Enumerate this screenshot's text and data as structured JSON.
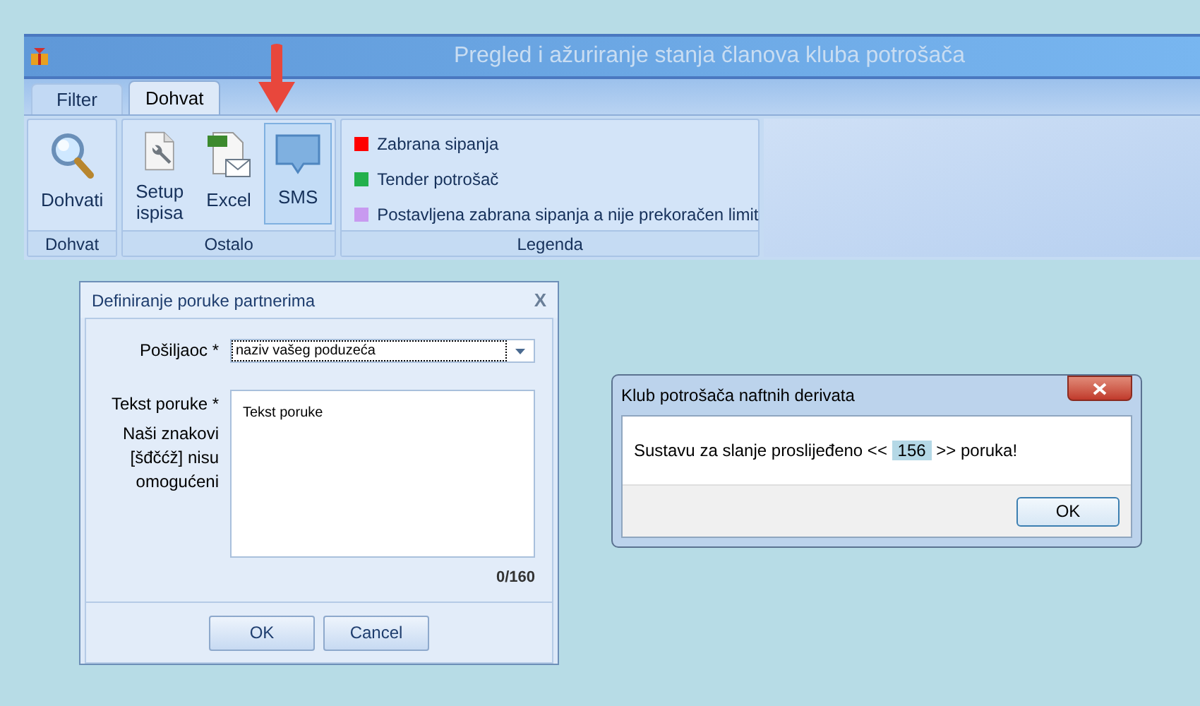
{
  "window": {
    "title": "Pregled i ažuriranje stanja članova kluba potrošača"
  },
  "tabs": [
    {
      "label": "Filter",
      "selected": false
    },
    {
      "label": "Dohvat",
      "selected": true
    }
  ],
  "ribbon": {
    "groups": [
      {
        "label": "Dohvat",
        "kind": "buttons",
        "buttons": [
          {
            "label": "Dohvati",
            "kind": "search",
            "selected": false
          }
        ]
      },
      {
        "label": "Ostalo",
        "kind": "buttons",
        "buttons": [
          {
            "label": "Setup ispisa",
            "kind": "setup",
            "selected": false
          },
          {
            "label": "Excel",
            "kind": "excel",
            "selected": false
          },
          {
            "label": "SMS",
            "kind": "sms",
            "selected": true
          }
        ]
      },
      {
        "label": "Legenda",
        "kind": "legend",
        "items": [
          {
            "label": "Zabrana sipanja",
            "color": "#ff0000"
          },
          {
            "label": "Tender potrošač",
            "color": "#22b04c"
          },
          {
            "label": "Postavljena zabrana sipanja a nije prekoračen limit",
            "color": "#c89af0"
          }
        ]
      }
    ]
  },
  "message_dialog": {
    "title": "Definiranje poruke partnerima",
    "close": "X",
    "sender_label": "Pošiljaoc *",
    "sender_value": "naziv vašeg poduzeća",
    "text_label": "Tekst poruke *",
    "note": "Naši znakovi [šđčćž] nisu omogućeni",
    "text_value": "Tekst poruke",
    "counter": "0/160",
    "buttons": [
      "OK",
      "Cancel"
    ]
  },
  "info_dialog": {
    "title": "Klub potrošača naftnih derivata",
    "message_before": "Sustavu za slanje proslijeđeno <<",
    "count": "156",
    "message_after": ">> poruka!",
    "button": "OK"
  }
}
